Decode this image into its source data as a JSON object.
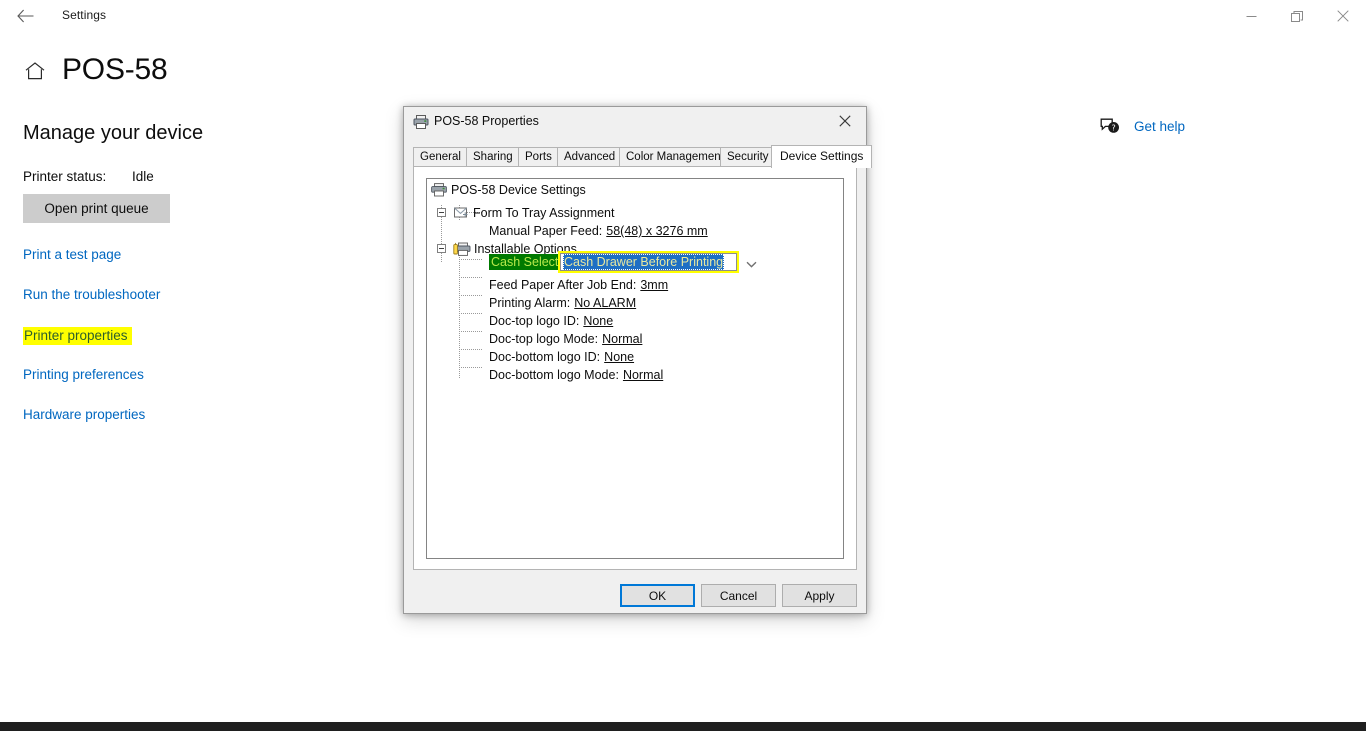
{
  "window": {
    "app_title": "Settings",
    "back_icon": "back-arrow-icon",
    "minimize_label": "Minimize",
    "maximize_label": "Restore",
    "close_label": "Close"
  },
  "page": {
    "home_icon": "home-icon",
    "title": "POS-58",
    "section_heading": "Manage your device",
    "printer_status_label": "Printer status:",
    "printer_status_value": "Idle",
    "open_print_queue": "Open print queue",
    "links": [
      {
        "label": "Print a test page",
        "highlighted": false
      },
      {
        "label": "Run the troubleshooter",
        "highlighted": false
      },
      {
        "label": "Printer properties",
        "highlighted": true
      },
      {
        "label": "Printing preferences",
        "highlighted": false
      },
      {
        "label": "Hardware properties",
        "highlighted": false
      }
    ]
  },
  "help": {
    "icon": "question-bubble-icon",
    "label": "Get help"
  },
  "dialog": {
    "title": "POS-58 Properties",
    "icon": "printer-icon",
    "close_label": "Close",
    "tabs": [
      {
        "label": "General",
        "active": false
      },
      {
        "label": "Sharing",
        "active": false
      },
      {
        "label": "Ports",
        "active": false
      },
      {
        "label": "Advanced",
        "active": false
      },
      {
        "label": "Color Management",
        "active": false
      },
      {
        "label": "Security",
        "active": false
      },
      {
        "label": "Device Settings",
        "active": true
      }
    ],
    "tree": {
      "root": "POS-58 Device Settings",
      "group_form": "Form To Tray Assignment",
      "form_item_label": "Manual Paper Feed:",
      "form_item_value": "58(48) x 3276 mm",
      "group_installable": "Installable Options",
      "cash_select_label": "Cash Select:",
      "cash_select_value": "Cash Drawer Before Printing",
      "options": [
        {
          "label": "Feed Paper After Job End:",
          "value": "3mm"
        },
        {
          "label": "Printing Alarm:",
          "value": "No ALARM"
        },
        {
          "label": "Doc-top logo ID:",
          "value": "None"
        },
        {
          "label": "Doc-top logo Mode:",
          "value": "Normal"
        },
        {
          "label": "Doc-bottom logo ID:",
          "value": "None"
        },
        {
          "label": "Doc-bottom logo Mode:",
          "value": "Normal"
        }
      ]
    },
    "buttons": {
      "ok": "OK",
      "cancel": "Cancel",
      "apply": "Apply"
    }
  },
  "colors": {
    "link_blue": "#0067c0",
    "highlight_yellow": "#ffff00",
    "highlight_green": "#007a00",
    "selection_blue": "#1e6fc4",
    "focus_blue": "#0078d7"
  }
}
